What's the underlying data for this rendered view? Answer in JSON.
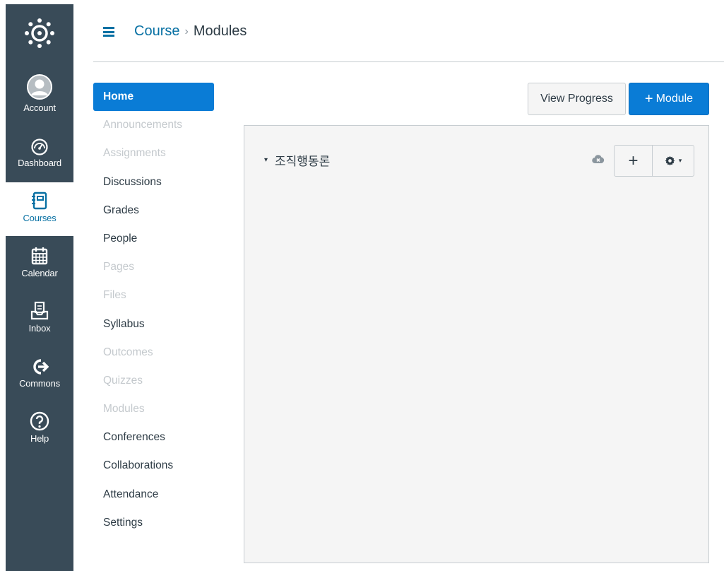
{
  "global_nav": {
    "items": [
      {
        "label": "Account",
        "icon": "account-icon"
      },
      {
        "label": "Dashboard",
        "icon": "dashboard-icon"
      },
      {
        "label": "Courses",
        "icon": "courses-icon",
        "active": true
      },
      {
        "label": "Calendar",
        "icon": "calendar-icon"
      },
      {
        "label": "Inbox",
        "icon": "inbox-icon"
      },
      {
        "label": "Commons",
        "icon": "commons-icon"
      },
      {
        "label": "Help",
        "icon": "help-icon"
      }
    ]
  },
  "breadcrumb": {
    "course": "Course",
    "separator": "›",
    "current": "Modules"
  },
  "course_nav": {
    "items": [
      {
        "label": "Home",
        "state": "active"
      },
      {
        "label": "Announcements",
        "state": "disabled"
      },
      {
        "label": "Assignments",
        "state": "disabled"
      },
      {
        "label": "Discussions",
        "state": "enabled"
      },
      {
        "label": "Grades",
        "state": "enabled"
      },
      {
        "label": "People",
        "state": "enabled"
      },
      {
        "label": "Pages",
        "state": "disabled"
      },
      {
        "label": "Files",
        "state": "disabled"
      },
      {
        "label": "Syllabus",
        "state": "enabled"
      },
      {
        "label": "Outcomes",
        "state": "disabled"
      },
      {
        "label": "Quizzes",
        "state": "disabled"
      },
      {
        "label": "Modules",
        "state": "disabled"
      },
      {
        "label": "Conferences",
        "state": "enabled"
      },
      {
        "label": "Collaborations",
        "state": "enabled"
      },
      {
        "label": "Attendance",
        "state": "enabled"
      },
      {
        "label": "Settings",
        "state": "enabled"
      }
    ]
  },
  "toolbar": {
    "view_progress_label": "View Progress",
    "add_module_plus": "+",
    "add_module_label": "Module"
  },
  "module": {
    "caret": "▾",
    "name": "조직행동론",
    "add_item_label": "+",
    "settings_caret": "▾"
  },
  "colors": {
    "nav_bg": "#394b58",
    "accent": "#0a7cd6",
    "link": "#0770a3",
    "disabled_text": "#c4c9cd"
  }
}
